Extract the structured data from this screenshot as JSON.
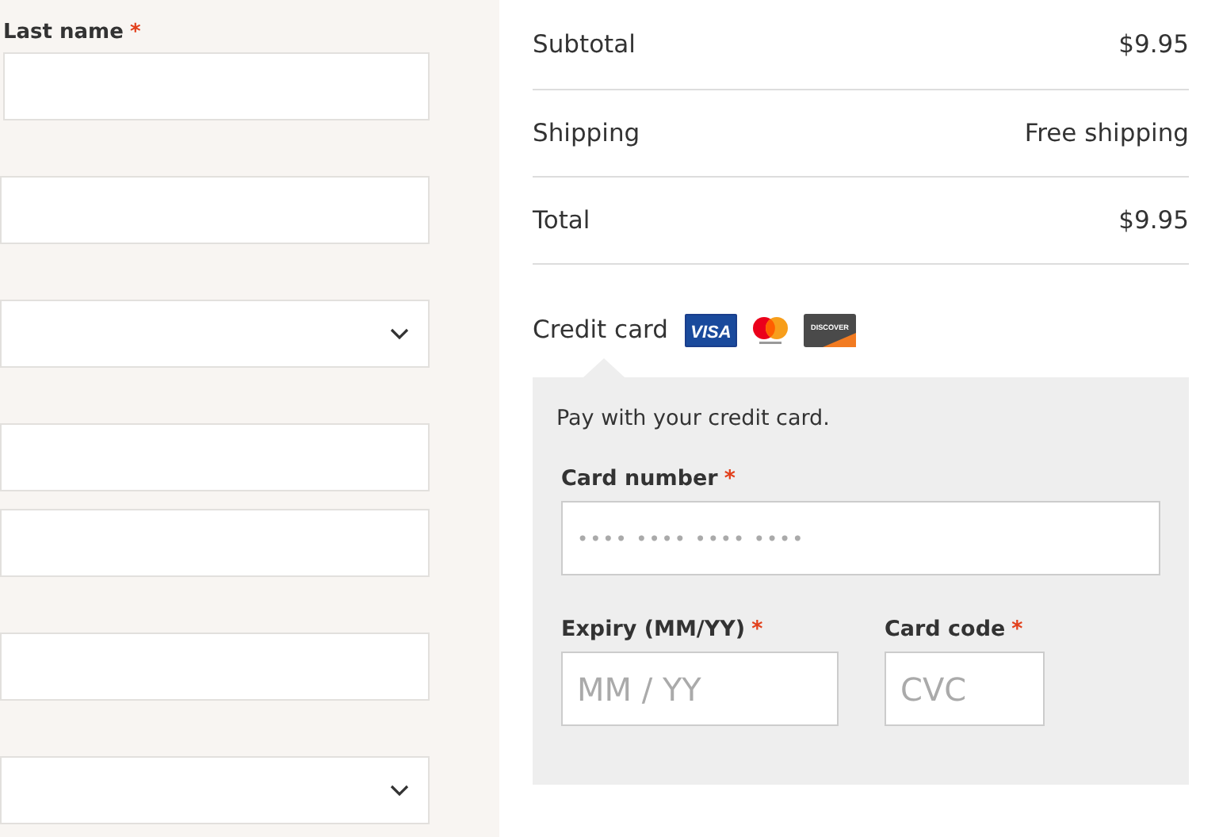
{
  "billing_form": {
    "fields": [
      {
        "kind": "text",
        "label": "Last name",
        "required_mark": "*"
      },
      {
        "kind": "text"
      },
      {
        "kind": "select"
      },
      {
        "kind": "text"
      },
      {
        "kind": "line2"
      },
      {
        "kind": "text"
      },
      {
        "kind": "select"
      }
    ]
  },
  "order_summary": {
    "rows": [
      {
        "label": "Subtotal",
        "value": "$9.95"
      },
      {
        "label": "Shipping",
        "value": "Free shipping"
      },
      {
        "label": "Total",
        "value": "$9.95"
      }
    ]
  },
  "payment": {
    "method": "Credit card",
    "logos": [
      {
        "kind": "visa",
        "text": "VISA"
      },
      {
        "kind": "mastercard"
      },
      {
        "kind": "discover",
        "text": "DISCOVER"
      }
    ],
    "description": "Pay with your credit card.",
    "card_number": {
      "label": "Card number",
      "required_mark": "*",
      "placeholder": "•••• •••• •••• ••••"
    },
    "expiry": {
      "label": "Expiry (MM/YY)",
      "required_mark": "*",
      "placeholder": "MM / YY"
    },
    "card_code": {
      "label": "Card code",
      "required_mark": "*",
      "placeholder": "CVC"
    }
  }
}
